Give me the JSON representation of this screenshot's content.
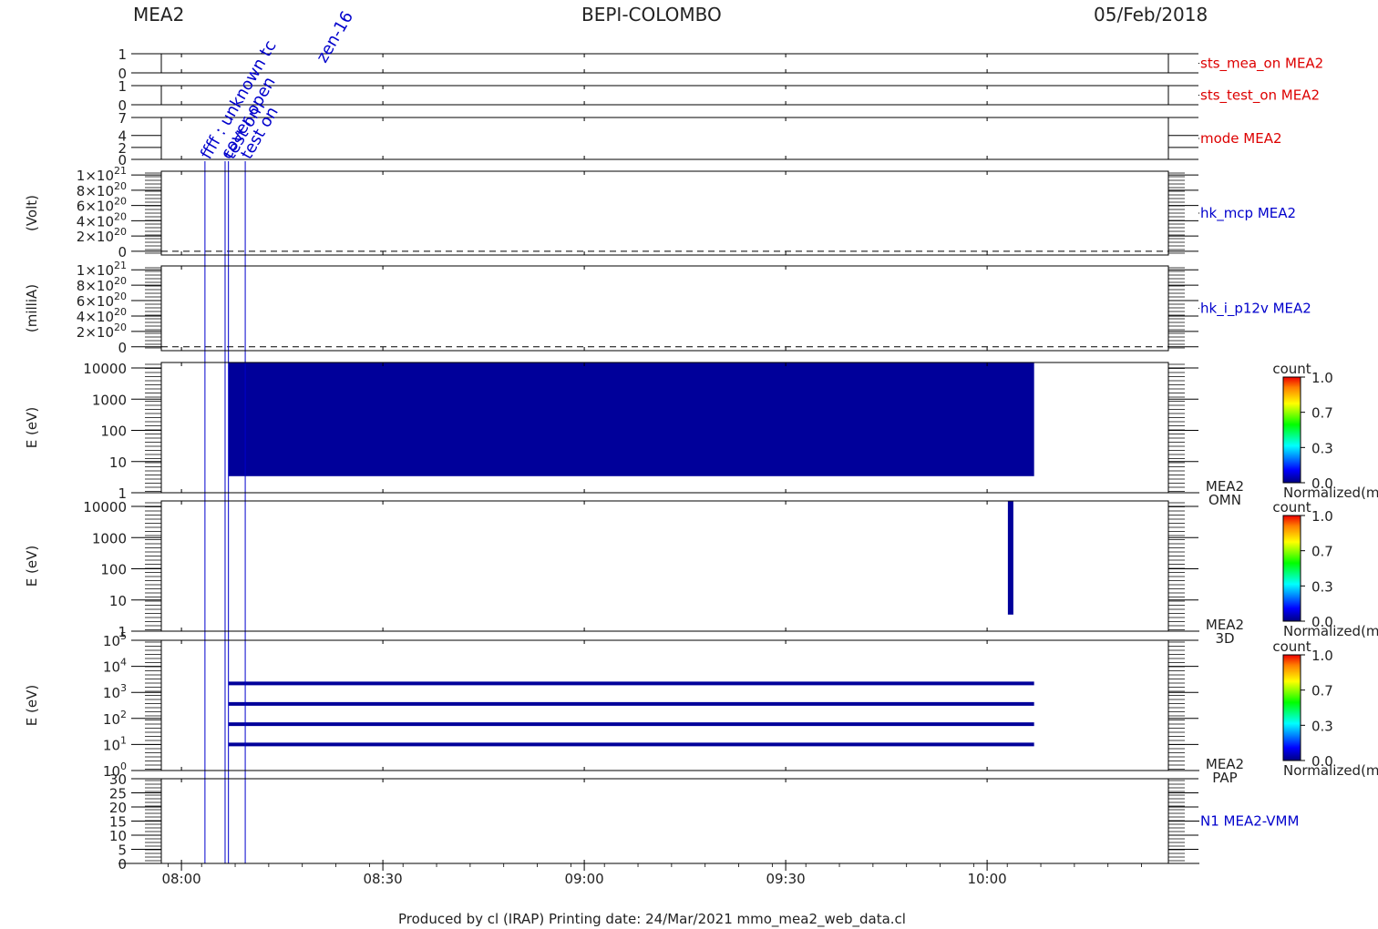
{
  "header": {
    "instrument": "MEA2",
    "mission": "BEPI-COLOMBO",
    "date": "05/Feb/2018"
  },
  "footer": {
    "text": "Produced by cl (IRAP)    Printing date: 24/Mar/2021    mmo_mea2_web_data.cl"
  },
  "colors": {
    "axis": "#000000",
    "series_red": "#dd0000",
    "series_blue": "#0000cc",
    "fill_navy": "#00009a",
    "event_line": "#0000cc"
  },
  "chart_data": {
    "type": "multi-panel time series",
    "x_range": [
      "07:57",
      "10:27"
    ],
    "x_ticks": [
      "08:00",
      "08:30",
      "09:00",
      "09:30",
      "10:00"
    ],
    "events": [
      {
        "time": "08:03.5",
        "label": "ffff : unknown tc"
      },
      {
        "time": "08:06.5",
        "label": "cover open"
      },
      {
        "time": "08:07",
        "label": "test on"
      },
      {
        "time": "08:09.5",
        "label": "test on"
      }
    ],
    "event_annotation_fragment": "zen-16",
    "panels": [
      {
        "id": "sts_mea_on",
        "label": "sts_mea_on MEA2",
        "label_color": "red",
        "yticks": [
          "1",
          "0"
        ],
        "ylim": [
          0,
          1
        ]
      },
      {
        "id": "sts_test_on",
        "label": "sts_test_on MEA2",
        "label_color": "red",
        "yticks": [
          "1",
          "0"
        ],
        "ylim": [
          0,
          1
        ]
      },
      {
        "id": "mode",
        "label": "mode MEA2",
        "label_color": "red",
        "yticks": [
          "7",
          "4",
          "2",
          "0"
        ],
        "ylim": [
          0,
          7
        ]
      },
      {
        "id": "hk_mcp",
        "label": "hk_mcp MEA2",
        "label_color": "blue",
        "ylabel": "(Volt)",
        "yticks": [
          {
            "base": "1×10",
            "exp": "21",
            "value": 1e+21
          },
          {
            "base": "8×10",
            "exp": "20",
            "value": 8e+20
          },
          {
            "base": "6×10",
            "exp": "20",
            "value": 6e+20
          },
          {
            "base": "4×10",
            "exp": "20",
            "value": 4e+20
          },
          {
            "base": "2×10",
            "exp": "20",
            "value": 2e+20
          },
          {
            "base": "0",
            "exp": "",
            "value": 0
          }
        ],
        "ylim": [
          -5e+19,
          1.05e+21
        ],
        "zero_line": "dashed"
      },
      {
        "id": "hk_i_p12v",
        "label": "hk_i_p12v MEA2",
        "label_color": "blue",
        "ylabel": "(milliA)",
        "yticks": [
          {
            "base": "1×10",
            "exp": "21",
            "value": 1e+21
          },
          {
            "base": "8×10",
            "exp": "20",
            "value": 8e+20
          },
          {
            "base": "6×10",
            "exp": "20",
            "value": 6e+20
          },
          {
            "base": "4×10",
            "exp": "20",
            "value": 4e+20
          },
          {
            "base": "2×10",
            "exp": "20",
            "value": 2e+20
          },
          {
            "base": "0",
            "exp": "",
            "value": 0
          }
        ],
        "ylim": [
          -5e+19,
          1.05e+21
        ],
        "zero_line": "dashed"
      },
      {
        "id": "omn",
        "label_line1": "MEA2",
        "label_line2": "OMN",
        "ylabel": "E (eV)",
        "scale": "log",
        "yticks": [
          "10000",
          "1000",
          "100",
          "10",
          "1"
        ],
        "ylim": [
          1,
          15000
        ],
        "data": {
          "start": "08:07",
          "end": "10:07",
          "e_min": 3.4,
          "e_max": 15000
        }
      },
      {
        "id": "3d",
        "label_line1": "MEA2",
        "label_line2": "3D",
        "ylabel": "E (eV)",
        "scale": "log",
        "yticks": [
          "10000",
          "1000",
          "100",
          "10",
          "1"
        ],
        "ylim": [
          1,
          15000
        ],
        "data": {
          "time": "10:03.5",
          "e_min": 3.4,
          "e_max": 15000
        }
      },
      {
        "id": "pap",
        "label_line1": "MEA2",
        "label_line2": "PAP",
        "ylabel": "E (eV)",
        "scale": "log",
        "yticks": [
          {
            "base": "10",
            "exp": "5",
            "value": 100000
          },
          {
            "base": "10",
            "exp": "4",
            "value": 10000
          },
          {
            "base": "10",
            "exp": "3",
            "value": 1000
          },
          {
            "base": "10",
            "exp": "2",
            "value": 100
          },
          {
            "base": "10",
            "exp": "1",
            "value": 10
          },
          {
            "base": "10",
            "exp": "0",
            "value": 1
          }
        ],
        "ylim": [
          1,
          100000
        ],
        "data": {
          "start": "08:07",
          "end": "10:07",
          "levels_ev": [
            2200,
            360,
            60,
            10
          ]
        }
      },
      {
        "id": "n1",
        "label": "N1 MEA2-VMM",
        "label_color": "blue",
        "yticks": [
          "30",
          "25",
          "20",
          "15",
          "10",
          "5",
          "0"
        ],
        "ylim": [
          0,
          30
        ]
      }
    ],
    "colorbars": [
      {
        "panel": "omn",
        "title": "count",
        "ticks": [
          "1.0",
          "0.7",
          "0.3",
          "0.0"
        ],
        "caption": "Normalized(m"
      },
      {
        "panel": "3d",
        "title": "count",
        "ticks": [
          "1.0",
          "0.7",
          "0.3",
          "0.0"
        ],
        "caption": "Normalized(m"
      },
      {
        "panel": "pap",
        "title": "count",
        "ticks": [
          "1.0",
          "0.7",
          "0.3",
          "0.0"
        ],
        "caption": "Normalized(m"
      }
    ]
  }
}
